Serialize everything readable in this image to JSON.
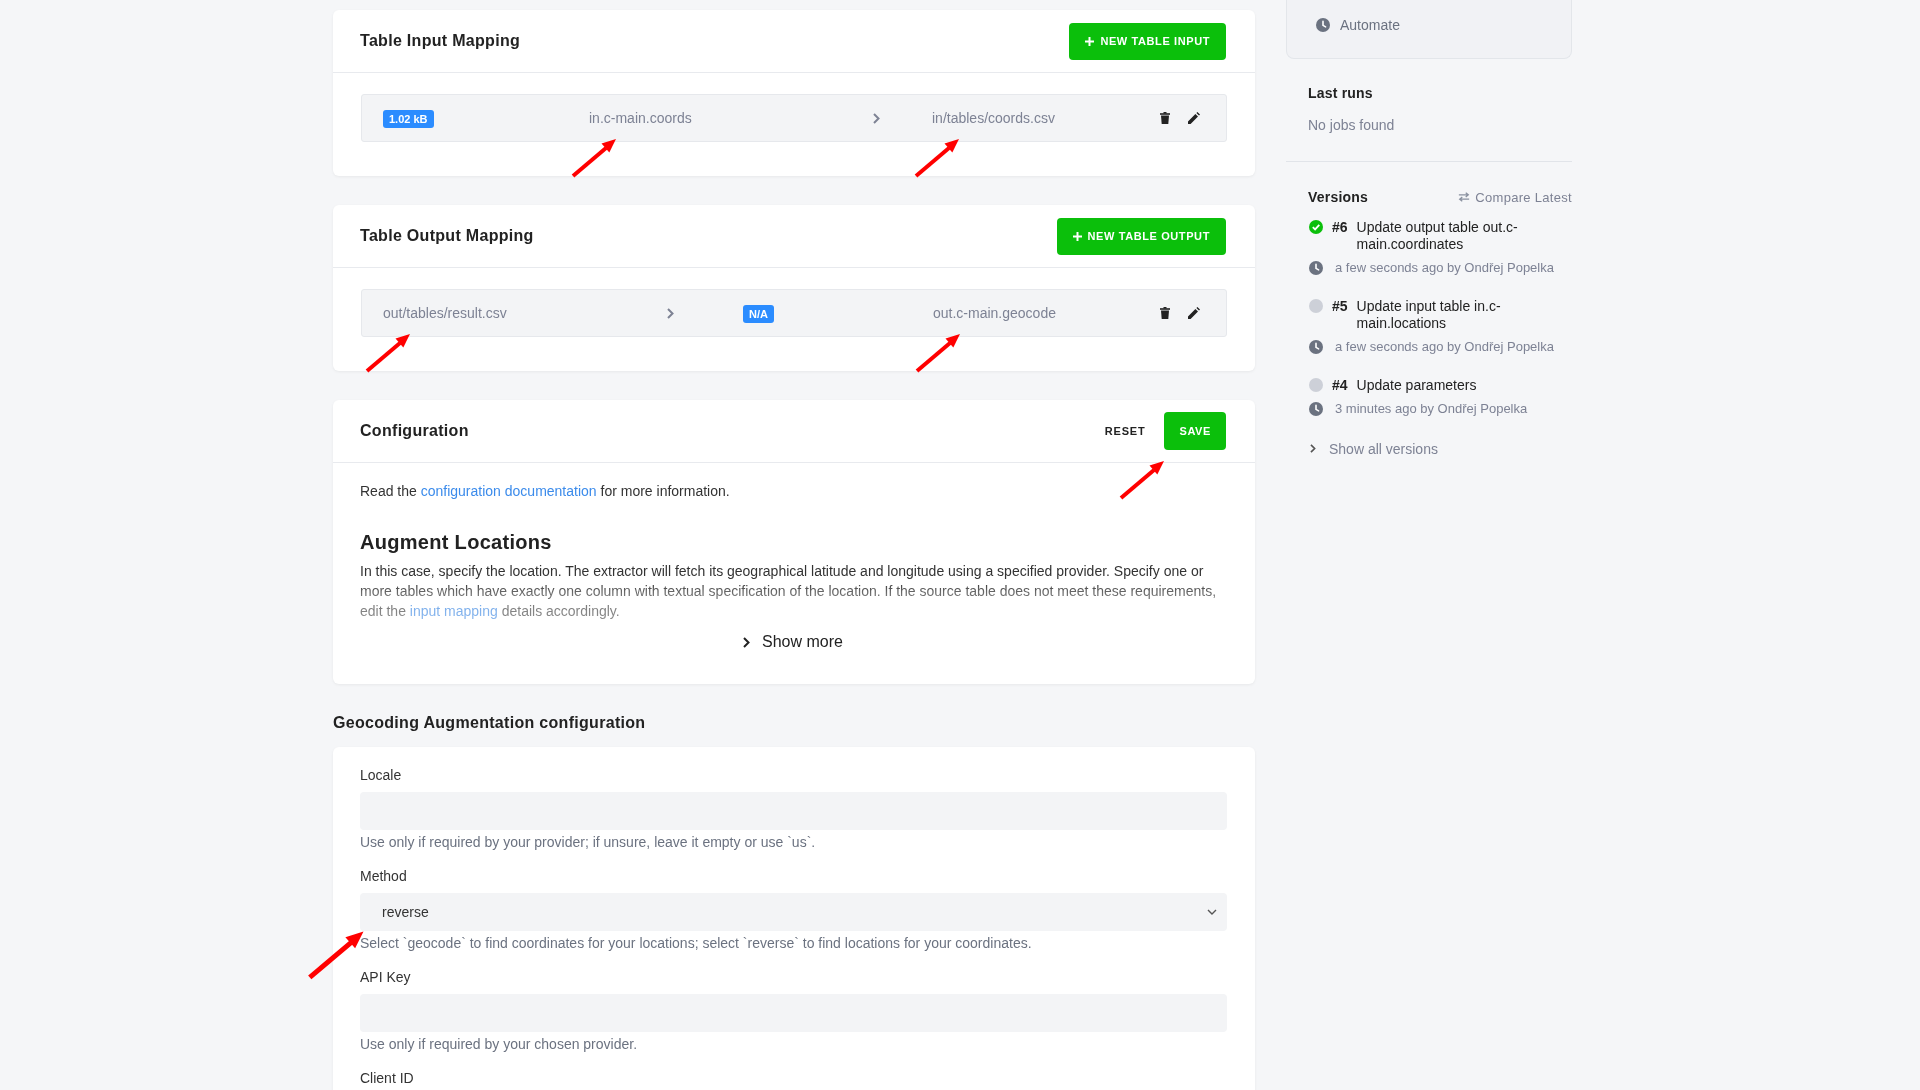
{
  "input_mapping": {
    "title": "Table Input Mapping",
    "button": "NEW TABLE INPUT",
    "rows": [
      {
        "size_badge": "1.02 kB",
        "source": "in.c-main.coords",
        "destination": "in/tables/coords.csv",
        "source_arrow": true,
        "destination_arrow": true
      }
    ]
  },
  "output_mapping": {
    "title": "Table Output Mapping",
    "button": "NEW TABLE OUTPUT",
    "rows": [
      {
        "source": "out/tables/result.csv",
        "size_badge": "N/A",
        "destination": "out.c-main.geocode",
        "source_arrow": true,
        "destination_arrow": true
      }
    ]
  },
  "configuration": {
    "title": "Configuration",
    "reset_button": "RESET",
    "save_button": {
      "label": "SAVE",
      "arrow": true
    },
    "intro": {
      "before": "Read the ",
      "link": "configuration documentation",
      "after": " for more information."
    },
    "heading": "Augment Locations",
    "description": {
      "before": "In this case, specify the location. The extractor will fetch its geographical latitude and longitude using a specified provider. Specify one or more tables which have exactly one column with textual specification of the location. If the source table does not meet these requirements, edit the ",
      "link": "input mapping",
      "after": " details accordingly."
    },
    "show_more": "Show more"
  },
  "geocoding": {
    "title": "Geocoding Augmentation configuration",
    "fields": [
      {
        "kind": "text",
        "label": "Locale",
        "help": "Use only if required by your provider; if unsure, leave it empty or use `us`.",
        "arrow": false
      },
      {
        "kind": "select",
        "label": "Method",
        "value": "reverse",
        "help": "Select `geocode` to find coordinates for your locations; select `reverse` to find locations for your coordinates.",
        "arrow": true
      },
      {
        "kind": "text",
        "label": "API Key",
        "help": "Use only if required by your chosen provider.",
        "arrow": false
      }
    ],
    "next_label": "Client ID"
  },
  "sidebar": {
    "menu": [
      {
        "label": "Automate"
      }
    ],
    "last_runs": {
      "title": "Last runs",
      "empty_text": "No jobs found"
    },
    "versions": {
      "title": "Versions",
      "compare_link": "Compare Latest",
      "items": [
        {
          "number": "#6",
          "title": "Update output table out.c-main.coordinates",
          "meta": "a few seconds ago by Ondřej Popelka",
          "current": true
        },
        {
          "number": "#5",
          "title": "Update input table in.c-main.locations",
          "meta": "a few seconds ago by Ondřej Popelka",
          "current": false
        },
        {
          "number": "#4",
          "title": "Update parameters",
          "meta": "3 minutes ago by Ondřej Popelka",
          "current": false
        }
      ],
      "show_all": "Show all versions"
    }
  }
}
